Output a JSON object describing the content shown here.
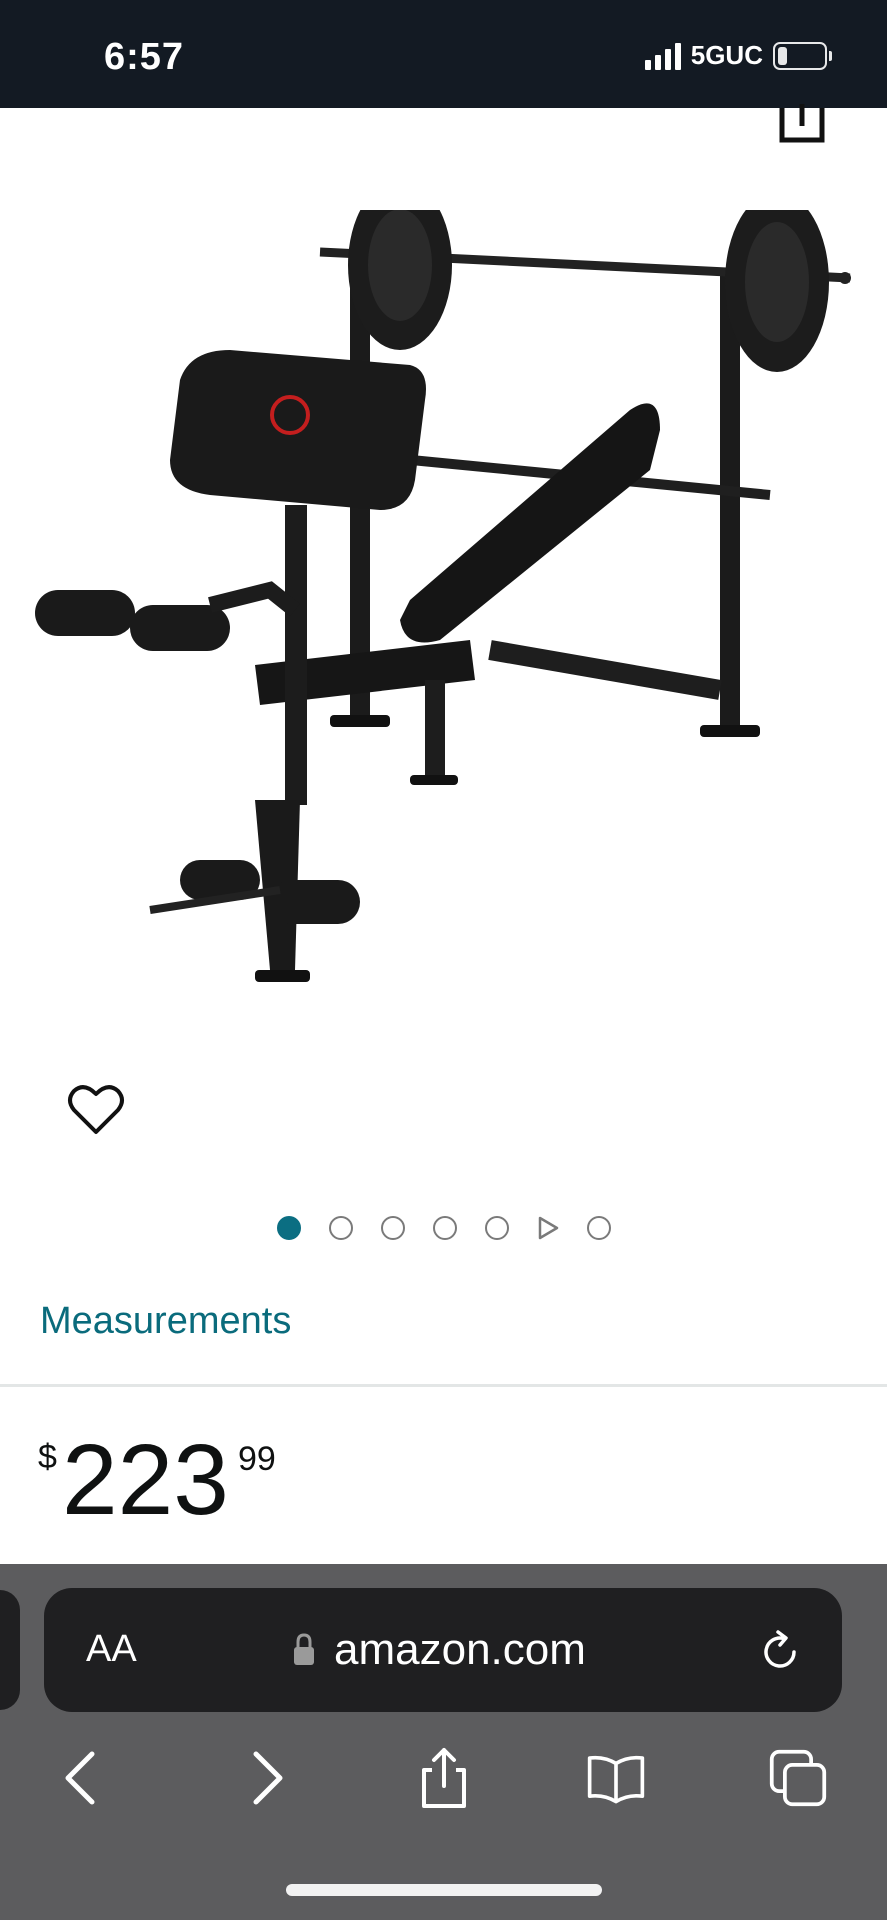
{
  "status_bar": {
    "time": "6:57",
    "network": "5GUC",
    "icons": [
      "signal-icon",
      "battery-icon"
    ]
  },
  "product": {
    "image_alt": "weight bench with barbell and plates",
    "favorite_icon": "heart-icon",
    "share_icon": "share-icon",
    "carousel": {
      "total": 7,
      "active_index": 0,
      "video_index": 5
    },
    "measurements_label": "Measurements",
    "price": {
      "symbol": "$",
      "whole": "223",
      "fraction": "99"
    }
  },
  "browser": {
    "text_size_label": "AA",
    "url": "amazon.com",
    "icons": [
      "lock-icon",
      "reload-icon",
      "back-icon",
      "forward-icon",
      "share-icon",
      "bookmarks-icon",
      "tabs-icon"
    ]
  },
  "colors": {
    "status_bar_bg": "#131a23",
    "accent_link": "#0a6b7c",
    "carousel_active": "#0b6e82",
    "browser_bg": "#5c5c5e",
    "url_pill_bg": "#1f1f21"
  }
}
